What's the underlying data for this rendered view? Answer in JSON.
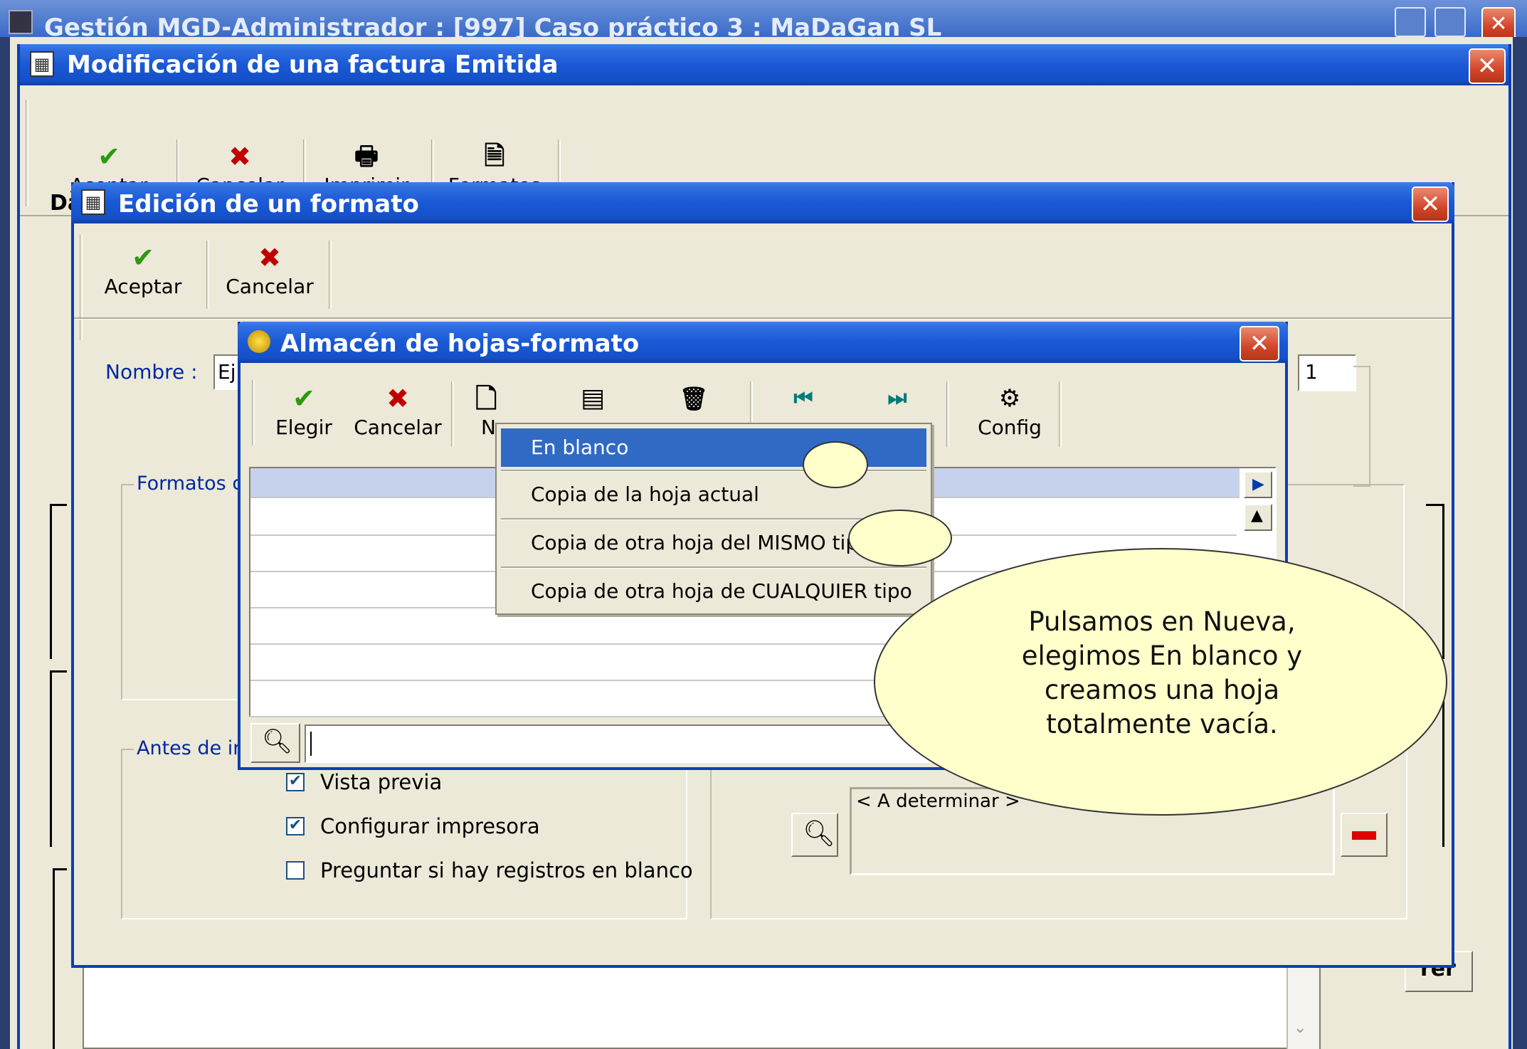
{
  "main_window": {
    "title": "Gestión MGD-Administrador : [997] Caso práctico 3 : MaDaGan SL"
  },
  "invoice_window": {
    "title": "Modificación de una factura Emitida",
    "toolbar": {
      "accept": "Aceptar",
      "cancel": "Cancelar",
      "print": "Imprimir",
      "formats": "Formatos"
    },
    "tab_label_partial": "Da",
    "right_button_partial": "rer"
  },
  "format_window": {
    "title": "Edición de un formato",
    "toolbar": {
      "accept": "Aceptar",
      "cancel": "Cancelar"
    },
    "name_label": "Nombre :",
    "name_value": "Ej",
    "copies_value": "1",
    "formats_group_label": "Formatos d",
    "before_print_group_label": "Antes de im",
    "checkboxes": [
      {
        "label": "Vista previa",
        "checked": true
      },
      {
        "label": "Configurar impresora",
        "checked": true
      },
      {
        "label": "Preguntar si hay registros en blanco",
        "checked": false
      }
    ],
    "to_determine": "< A determinar >"
  },
  "store_dialog": {
    "title": "Almacén de hojas-formato",
    "toolbar": {
      "choose": "Elegir",
      "cancel": "Cancelar",
      "new_partial": "Nu",
      "config": "Config"
    }
  },
  "new_menu": {
    "items": [
      {
        "label": "En blanco",
        "highlighted": true
      },
      {
        "label": "Copia de la hoja actual",
        "highlighted": false
      },
      {
        "label": "Copia de otra hoja del MISMO tipo",
        "highlighted": false
      },
      {
        "label": "Copia de otra hoja de CUALQUIER tipo",
        "highlighted": false
      }
    ]
  },
  "callout": {
    "text": "Pulsamos en Nueva, elegimos En blanco y creamos una hoja totalmente vacía."
  },
  "colors": {
    "xp_title_blue": "#1a58d6",
    "face": "#ece9d8",
    "menu_highlight": "#316ac5",
    "callout_fill": "#ffffcc",
    "close_red": "#d2452a"
  }
}
